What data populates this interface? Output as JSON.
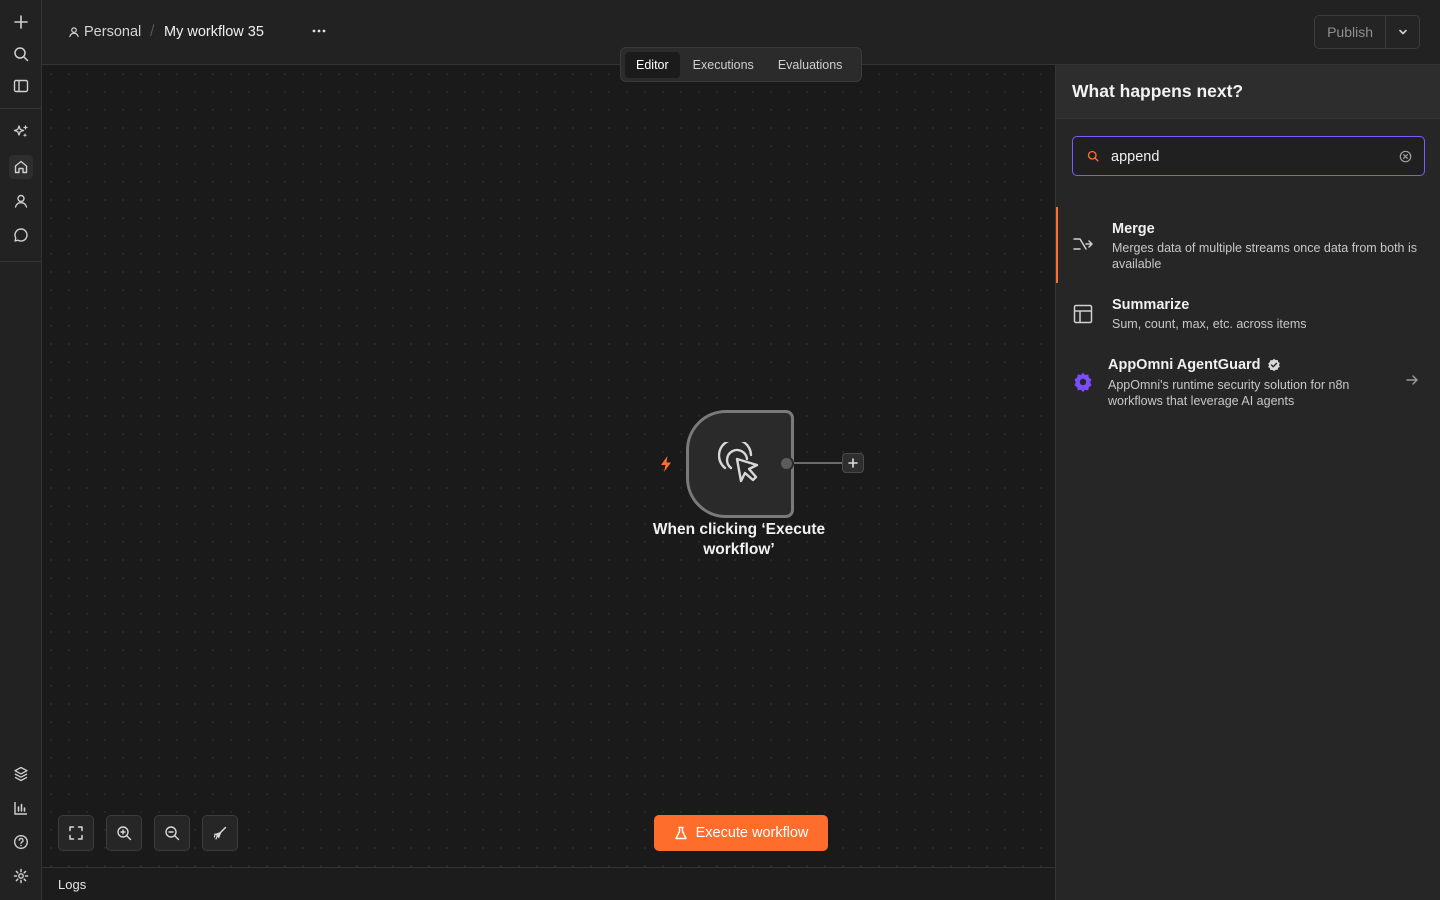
{
  "header": {
    "project": "Personal",
    "separator": "/",
    "workflow_name": "My workflow 35",
    "more": "···",
    "publish_label": "Publish"
  },
  "tabs": [
    {
      "label": "Editor",
      "active": true
    },
    {
      "label": "Executions",
      "active": false
    },
    {
      "label": "Evaluations",
      "active": false
    }
  ],
  "rail": {
    "top_icons": [
      "plus-icon",
      "search-icon",
      "sidebar-toggle-icon"
    ],
    "nav_icons": [
      "sparkles-icon",
      "home-icon",
      "user-icon",
      "chat-icon"
    ],
    "bottom_icons": [
      "templates-icon",
      "insights-icon",
      "help-icon",
      "settings-icon"
    ]
  },
  "canvas": {
    "node_label": "When clicking ‘Execute workflow’",
    "execute_label": "Execute workflow",
    "accent_color": "#ff6d2d"
  },
  "logs": {
    "label": "Logs"
  },
  "panel": {
    "title": "What happens next?",
    "search_value": "append",
    "results": [
      {
        "title": "Merge",
        "description": "Merges data of multiple streams once data from both is available",
        "icon": "merge-icon"
      },
      {
        "title": "Summarize",
        "description": "Sum, count, max, etc. across items",
        "icon": "table-icon"
      },
      {
        "title": "AppOmni AgentGuard",
        "description": "AppOmni's runtime security solution for n8n workflows that leverage AI agents",
        "icon": "gear-badge-icon",
        "verified": true
      }
    ]
  }
}
